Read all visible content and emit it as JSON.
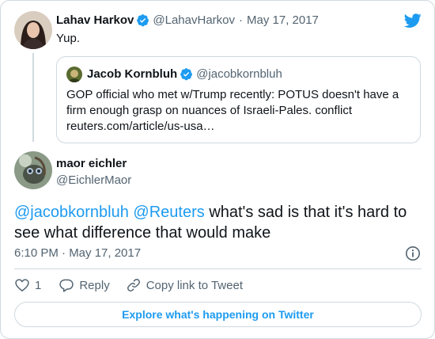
{
  "parent_tweet": {
    "author_name": "Lahav Harkov",
    "author_handle": "@LahavHarkov",
    "separator": "·",
    "date": "May 17, 2017",
    "text": "Yup."
  },
  "quoted_tweet": {
    "author_name": "Jacob Kornbluh",
    "author_handle": "@jacobkornbluh",
    "text": "GOP official who met w/Trump recently: POTUS doesn't have a firm enough grasp on nuances of Israeli-Pales. conflict reuters.com/article/us-usa…"
  },
  "main_tweet": {
    "author_name": "maor eichler",
    "author_handle": "@EichlerMaor",
    "mention_1": "@jacobkornbluh",
    "mention_2": "@Reuters",
    "text": "what's sad is that it's hard to see what difference that would make",
    "timestamp": "6:10 PM · May 17, 2017"
  },
  "actions": {
    "like_count": "1",
    "reply_label": "Reply",
    "copy_link_label": "Copy link to Tweet"
  },
  "explore_label": "Explore what's happening on Twitter",
  "colors": {
    "accent": "#1d9bf0",
    "text": "#0f1419",
    "muted": "#536471",
    "border": "#cfd9de"
  },
  "icons": [
    "twitter-bird-icon",
    "verified-badge-icon",
    "info-icon",
    "heart-icon",
    "reply-bubble-icon",
    "link-icon"
  ]
}
